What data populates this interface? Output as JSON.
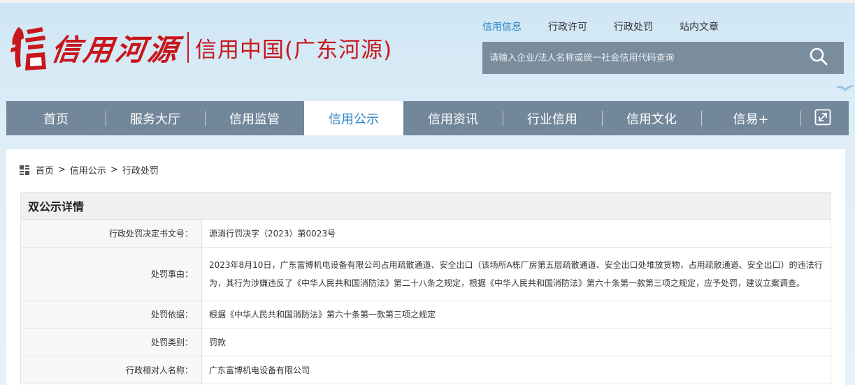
{
  "header": {
    "logo_script": "信用河源",
    "logo_site": "信用中国(广东河源)",
    "top_links": [
      {
        "label": "信用信息",
        "active": true
      },
      {
        "label": "行政许可",
        "active": false
      },
      {
        "label": "行政处罚",
        "active": false
      },
      {
        "label": "站内文章",
        "active": false
      }
    ],
    "search": {
      "placeholder": "请输入企业/法人名称或统一社会信用代码查询",
      "value": "",
      "icon": "search-icon"
    }
  },
  "nav": {
    "items": [
      {
        "label": "首页",
        "active": false
      },
      {
        "label": "服务大厅",
        "active": false
      },
      {
        "label": "信用监管",
        "active": false
      },
      {
        "label": "信用公示",
        "active": true
      },
      {
        "label": "信用资讯",
        "active": false
      },
      {
        "label": "行业信用",
        "active": false
      },
      {
        "label": "信用文化",
        "active": false
      },
      {
        "label": "信易+",
        "active": false
      }
    ],
    "expand_icon": "expand-icon"
  },
  "breadcrumb": {
    "icon": "grid-icon",
    "items": [
      "首页",
      "信用公示",
      "行政处罚"
    ],
    "separator": ">"
  },
  "section": {
    "title": "双公示详情"
  },
  "details": {
    "rows": [
      {
        "key": "行政处罚决定书文号：",
        "value": "源消行罚决字（2023）第0023号"
      },
      {
        "key": "处罚事由：",
        "value": "2023年8月10日，广东富博机电设备有限公司占用疏散通道、安全出口（该场所A栋厂房第五层疏散通道、安全出口处堆放货物，占用疏散通道、安全出口）的违法行为，其行为涉嫌违反了《中华人民共和国消防法》第二十八条之规定，根据《中华人民共和国消防法》第六十条第一款第三项之规定，应予处罚，建议立案调查。"
      },
      {
        "key": "处罚依据：",
        "value": "根据《中华人民共和国消防法》第六十条第一款第三项之规定"
      },
      {
        "key": "处罚类别：",
        "value": "罚款"
      },
      {
        "key": "行政相对人名称：",
        "value": "广东富博机电设备有限公司"
      }
    ]
  },
  "colors": {
    "brand_red": "#c8161d",
    "accent_blue": "#2b83c6",
    "nav_bg": "#72879a",
    "search_bg": "#7a8d9c"
  }
}
